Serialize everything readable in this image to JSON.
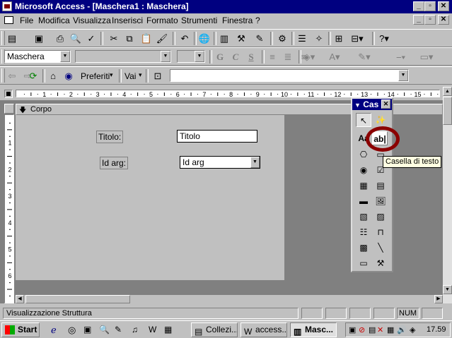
{
  "window": {
    "title": "Microsoft Access - [Maschera1 : Maschera]"
  },
  "menu": [
    "File",
    "Modifica",
    "Visualizza",
    "Inserisci",
    "Formato",
    "Strumenti",
    "Finestra",
    "?"
  ],
  "format_toolbar": {
    "object_combo": "Maschera",
    "font_combo": "",
    "size_combo": "",
    "bold": "G",
    "italic": "C",
    "underline": "S"
  },
  "web_toolbar": {
    "favorites": "Preferiti",
    "go": "Vai",
    "address": ""
  },
  "ruler": {
    "labels": [
      "1",
      "2",
      "3",
      "4",
      "5",
      "6",
      "7",
      "8",
      "9",
      "10",
      "11",
      "12",
      "13",
      "14",
      "15"
    ]
  },
  "vruler": {
    "labels": [
      "1",
      "2",
      "3",
      "4",
      "5",
      "6"
    ]
  },
  "section": {
    "label": "Corpo"
  },
  "form": {
    "title_label": "Titolo:",
    "title_field": "Titolo",
    "idarg_label": "Id arg:",
    "idarg_field": "Id arg"
  },
  "toolbox": {
    "title": "Cas",
    "textbox_tool": "ab|"
  },
  "tooltip": "Casella di testo",
  "statusbar": {
    "text": "Visualizzazione Struttura",
    "num": "NUM"
  },
  "taskbar": {
    "start": "Start",
    "buttons": [
      "Collezi...",
      "access...",
      "Masc..."
    ],
    "clock": "17.59"
  },
  "colors": {
    "titlebar": "#000080",
    "highlight_circle": "#8b0000",
    "tooltip_bg": "#ffffe1"
  }
}
